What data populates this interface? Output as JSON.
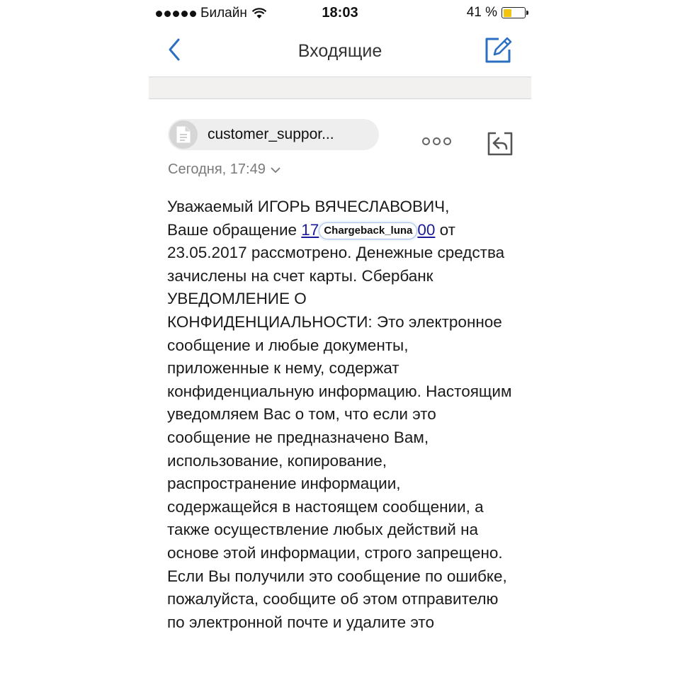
{
  "status_bar": {
    "carrier": "Билайн",
    "time": "18:03",
    "battery_percent": "41 %",
    "battery_level": 0.41
  },
  "nav": {
    "title": "Входящие",
    "back_icon": "chevron-left-icon",
    "compose_icon": "compose-icon"
  },
  "message": {
    "sender": "customer_suppor...",
    "date": "Сегодня, 17:49",
    "link_start": "17",
    "link_end": "00",
    "watermark": "Chargeback_luna",
    "body_line1": "Уважаемый ИГОРЬ ВЯЧЕСЛАВОВИЧ,",
    "body_prefix": "Ваше обращение ",
    "body_suffix": " от",
    "body_rest": "23.05.2017 рассмотрено. Денежные средства зачислены на счет карты. Сбербанк УВЕДОМЛЕНИЕ О КОНФИДЕНЦИАЛЬНОСТИ: Это электронное сообщение и любые документы, приложенные к нему, содержат конфиденциальную информацию. Настоящим уведомляем Вас о том, что если это сообщение не предназначено Вам, использование, копирование, распространение информации, содержащейся в настоящем сообщении, а также осуществление любых действий на основе этой информации, строго запрещено. Если Вы получили это сообщение по ошибке, пожалуйста, сообщите об этом отправителю по электронной почте и удалите это"
  },
  "colors": {
    "accent": "#2a6fc1",
    "battery": "#f1c40f",
    "link": "#1a1a9a"
  }
}
